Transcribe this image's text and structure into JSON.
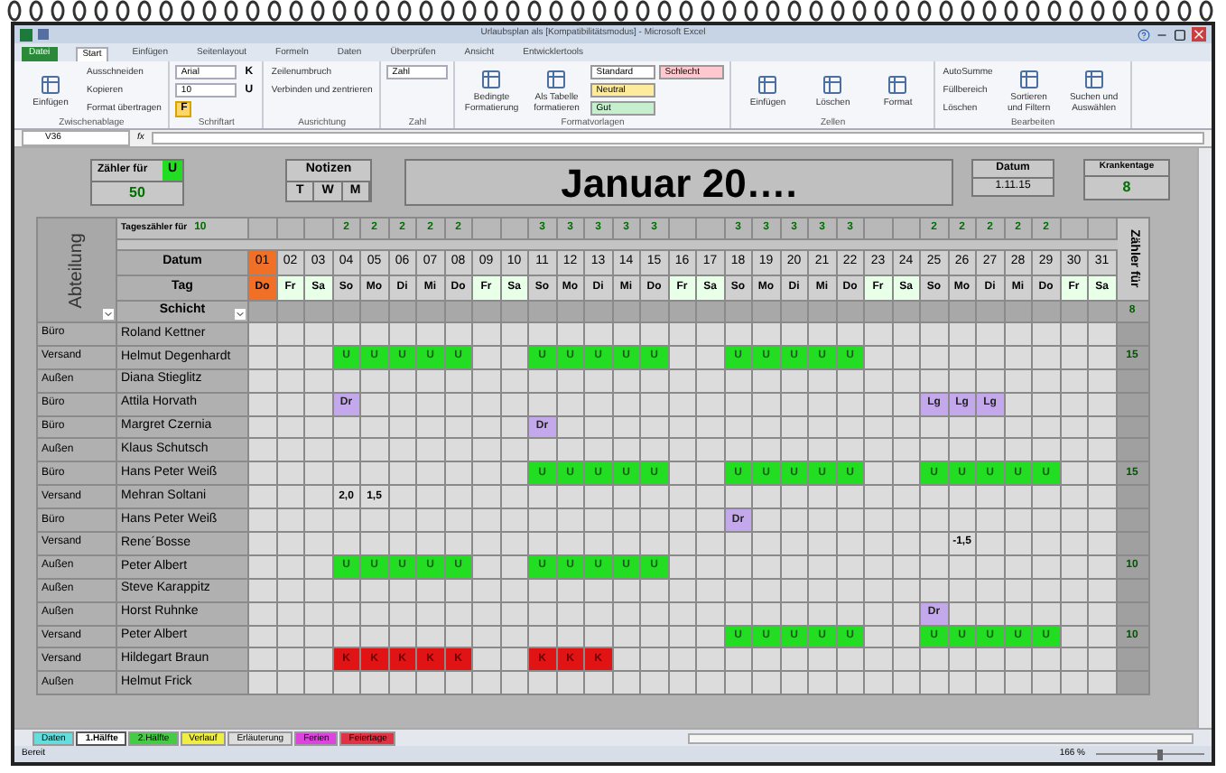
{
  "window": {
    "title": "Urlaubsplan als [Kompatibilitätsmodus] - Microsoft Excel"
  },
  "ribbon": {
    "file_tab": "Datei",
    "tabs": [
      {
        "label": "Start",
        "selected": true
      },
      {
        "label": "Einfügen",
        "selected": false
      },
      {
        "label": "Seitenlayout",
        "selected": false
      },
      {
        "label": "Formeln",
        "selected": false
      },
      {
        "label": "Daten",
        "selected": false
      },
      {
        "label": "Überprüfen",
        "selected": false
      },
      {
        "label": "Ansicht",
        "selected": false
      },
      {
        "label": "Entwicklertools",
        "selected": false
      }
    ],
    "groups": [
      {
        "label": "Zwischenablage",
        "items": [
          {
            "kind": "large",
            "label": "Einfügen"
          },
          {
            "kind": "small",
            "label": "Ausschneiden"
          },
          {
            "kind": "small",
            "label": "Kopieren"
          },
          {
            "kind": "small",
            "label": "Format übertragen"
          }
        ]
      },
      {
        "label": "Schriftart",
        "items": [
          {
            "kind": "field",
            "label": "Arial"
          },
          {
            "kind": "field",
            "label": "10"
          },
          {
            "kind": "toggle",
            "label": "F",
            "selected": true
          },
          {
            "kind": "toggle",
            "label": "K",
            "selected": false
          },
          {
            "kind": "toggle",
            "label": "U",
            "selected": false
          }
        ]
      },
      {
        "label": "Ausrichtung",
        "items": [
          {
            "kind": "small",
            "label": "Zeilenumbruch"
          },
          {
            "kind": "small",
            "label": "Verbinden und zentrieren"
          }
        ]
      },
      {
        "label": "Zahl",
        "items": [
          {
            "kind": "field",
            "label": "Zahl"
          }
        ]
      },
      {
        "label": "Formatvorlagen",
        "items": [
          {
            "kind": "large",
            "label": "Bedingte Formatierung"
          },
          {
            "kind": "large",
            "label": "Als Tabelle formatieren"
          },
          {
            "kind": "style",
            "label": "Standard",
            "color": "#ffffff"
          },
          {
            "kind": "style",
            "label": "Neutral",
            "color": "#ffeb9c"
          },
          {
            "kind": "style",
            "label": "Gut",
            "color": "#c6efce"
          },
          {
            "kind": "style",
            "label": "Schlecht",
            "color": "#ffc7ce"
          }
        ]
      },
      {
        "label": "Zellen",
        "items": [
          {
            "kind": "large",
            "label": "Einfügen"
          },
          {
            "kind": "large",
            "label": "Löschen"
          },
          {
            "kind": "large",
            "label": "Format"
          }
        ]
      },
      {
        "label": "Bearbeiten",
        "items": [
          {
            "kind": "small",
            "label": "AutoSumme"
          },
          {
            "kind": "small",
            "label": "Füllbereich"
          },
          {
            "kind": "small",
            "label": "Löschen"
          },
          {
            "kind": "large",
            "label": "Sortieren und Filtern"
          },
          {
            "kind": "large",
            "label": "Suchen und Auswählen"
          }
        ]
      }
    ]
  },
  "formula_bar": {
    "name_box": "V36",
    "function_label": "fx"
  },
  "header": {
    "counter_label": "Zähler für",
    "counter_code": "U",
    "counter_value": "50",
    "notes_title": "Notizen",
    "notes_columns": [
      "T",
      "W",
      "M"
    ],
    "title": "Januar 20….",
    "date_label": "Datum",
    "date_value": "1.11.15",
    "sick_label": "Krankentage",
    "sick_value": "8"
  },
  "grid": {
    "department_heading": "Abteilung",
    "day_counter_label": "Tageszähler für",
    "day_counter_value": "10",
    "date_heading": "Datum",
    "weekday_heading": "Tag",
    "shift_heading": "Schicht",
    "total_heading": "Zähler für",
    "shift_total": "8",
    "days": [
      {
        "date": "01",
        "weekday": "Do",
        "kind": "holiday"
      },
      {
        "date": "02",
        "weekday": "Fr",
        "kind": "weekend"
      },
      {
        "date": "03",
        "weekday": "Sa",
        "kind": "weekend"
      },
      {
        "date": "04",
        "weekday": "So",
        "kind": "normal",
        "counter": "2"
      },
      {
        "date": "05",
        "weekday": "Mo",
        "kind": "normal",
        "counter": "2"
      },
      {
        "date": "06",
        "weekday": "Di",
        "kind": "normal",
        "counter": "2"
      },
      {
        "date": "07",
        "weekday": "Mi",
        "kind": "normal",
        "counter": "2"
      },
      {
        "date": "08",
        "weekday": "Do",
        "kind": "normal",
        "counter": "2"
      },
      {
        "date": "09",
        "weekday": "Fr",
        "kind": "weekend"
      },
      {
        "date": "10",
        "weekday": "Sa",
        "kind": "weekend"
      },
      {
        "date": "11",
        "weekday": "So",
        "kind": "normal",
        "counter": "3"
      },
      {
        "date": "12",
        "weekday": "Mo",
        "kind": "normal",
        "counter": "3"
      },
      {
        "date": "13",
        "weekday": "Di",
        "kind": "normal",
        "counter": "3"
      },
      {
        "date": "14",
        "weekday": "Mi",
        "kind": "normal",
        "counter": "3"
      },
      {
        "date": "15",
        "weekday": "Do",
        "kind": "normal",
        "counter": "3"
      },
      {
        "date": "16",
        "weekday": "Fr",
        "kind": "weekend"
      },
      {
        "date": "17",
        "weekday": "Sa",
        "kind": "weekend"
      },
      {
        "date": "18",
        "weekday": "So",
        "kind": "normal",
        "counter": "3"
      },
      {
        "date": "19",
        "weekday": "Mo",
        "kind": "normal",
        "counter": "3"
      },
      {
        "date": "20",
        "weekday": "Di",
        "kind": "normal",
        "counter": "3"
      },
      {
        "date": "21",
        "weekday": "Mi",
        "kind": "normal",
        "counter": "3"
      },
      {
        "date": "22",
        "weekday": "Do",
        "kind": "normal",
        "counter": "3"
      },
      {
        "date": "23",
        "weekday": "Fr",
        "kind": "weekend"
      },
      {
        "date": "24",
        "weekday": "Sa",
        "kind": "weekend"
      },
      {
        "date": "25",
        "weekday": "So",
        "kind": "normal",
        "counter": "2"
      },
      {
        "date": "26",
        "weekday": "Mo",
        "kind": "normal",
        "counter": "2"
      },
      {
        "date": "27",
        "weekday": "Di",
        "kind": "normal",
        "counter": "2"
      },
      {
        "date": "28",
        "weekday": "Mi",
        "kind": "normal",
        "counter": "2"
      },
      {
        "date": "29",
        "weekday": "Do",
        "kind": "normal",
        "counter": "2"
      },
      {
        "date": "30",
        "weekday": "Fr",
        "kind": "weekend"
      },
      {
        "date": "31",
        "weekday": "Sa",
        "kind": "weekend"
      }
    ],
    "employees": [
      {
        "department": "Büro",
        "name": "Roland Kettner",
        "cells": [
          {
            "kind": "empty"
          },
          {
            "kind": "empty"
          },
          {
            "kind": "empty"
          },
          {
            "kind": "empty"
          },
          {
            "kind": "empty"
          },
          {
            "kind": "empty"
          },
          {
            "kind": "empty"
          },
          {
            "kind": "empty"
          },
          {
            "kind": "empty"
          },
          {
            "kind": "empty"
          },
          {
            "kind": "empty"
          },
          {
            "kind": "empty"
          },
          {
            "kind": "empty"
          },
          {
            "kind": "empty"
          },
          {
            "kind": "empty"
          },
          {
            "kind": "empty"
          },
          {
            "kind": "empty"
          },
          {
            "kind": "empty"
          },
          {
            "kind": "empty"
          },
          {
            "kind": "empty"
          },
          {
            "kind": "empty"
          },
          {
            "kind": "empty"
          },
          {
            "kind": "empty"
          },
          {
            "kind": "empty"
          },
          {
            "kind": "empty"
          },
          {
            "kind": "empty"
          },
          {
            "kind": "empty"
          },
          {
            "kind": "empty"
          },
          {
            "kind": "empty"
          },
          {
            "kind": "empty"
          },
          {
            "kind": "empty"
          }
        ]
      },
      {
        "department": "Versand",
        "name": "Helmut Degenhardt",
        "total": "15",
        "cells": [
          {
            "kind": "empty"
          },
          {
            "kind": "empty"
          },
          {
            "kind": "empty"
          },
          {
            "kind": "vacation",
            "text": "U"
          },
          {
            "kind": "vacation",
            "text": "U"
          },
          {
            "kind": "vacation",
            "text": "U"
          },
          {
            "kind": "vacation",
            "text": "U"
          },
          {
            "kind": "vacation",
            "text": "U"
          },
          {
            "kind": "empty"
          },
          {
            "kind": "empty"
          },
          {
            "kind": "vacation",
            "text": "U"
          },
          {
            "kind": "vacation",
            "text": "U"
          },
          {
            "kind": "vacation",
            "text": "U"
          },
          {
            "kind": "vacation",
            "text": "U"
          },
          {
            "kind": "vacation",
            "text": "U"
          },
          {
            "kind": "empty"
          },
          {
            "kind": "empty"
          },
          {
            "kind": "vacation",
            "text": "U"
          },
          {
            "kind": "vacation",
            "text": "U"
          },
          {
            "kind": "vacation",
            "text": "U"
          },
          {
            "kind": "vacation",
            "text": "U"
          },
          {
            "kind": "vacation",
            "text": "U"
          },
          {
            "kind": "empty"
          },
          {
            "kind": "empty"
          },
          {
            "kind": "empty"
          },
          {
            "kind": "empty"
          },
          {
            "kind": "empty"
          },
          {
            "kind": "empty"
          },
          {
            "kind": "empty"
          },
          {
            "kind": "empty"
          },
          {
            "kind": "empty"
          }
        ]
      },
      {
        "department": "Außen",
        "name": "Diana Stieglitz",
        "cells": [
          {
            "kind": "empty"
          },
          {
            "kind": "empty"
          },
          {
            "kind": "empty"
          },
          {
            "kind": "empty"
          },
          {
            "kind": "empty"
          },
          {
            "kind": "empty"
          },
          {
            "kind": "empty"
          },
          {
            "kind": "empty"
          },
          {
            "kind": "empty"
          },
          {
            "kind": "empty"
          },
          {
            "kind": "empty"
          },
          {
            "kind": "empty"
          },
          {
            "kind": "empty"
          },
          {
            "kind": "empty"
          },
          {
            "kind": "empty"
          },
          {
            "kind": "empty"
          },
          {
            "kind": "empty"
          },
          {
            "kind": "empty"
          },
          {
            "kind": "empty"
          },
          {
            "kind": "empty"
          },
          {
            "kind": "empty"
          },
          {
            "kind": "empty"
          },
          {
            "kind": "empty"
          },
          {
            "kind": "empty"
          },
          {
            "kind": "empty"
          },
          {
            "kind": "empty"
          },
          {
            "kind": "empty"
          },
          {
            "kind": "empty"
          },
          {
            "kind": "empty"
          },
          {
            "kind": "empty"
          },
          {
            "kind": "empty"
          }
        ]
      },
      {
        "department": "Büro",
        "name": "Attila Horvath",
        "cells": [
          {
            "kind": "empty"
          },
          {
            "kind": "empty"
          },
          {
            "kind": "empty"
          },
          {
            "kind": "training",
            "text": "Dr"
          },
          {
            "kind": "empty"
          },
          {
            "kind": "empty"
          },
          {
            "kind": "empty"
          },
          {
            "kind": "empty"
          },
          {
            "kind": "empty"
          },
          {
            "kind": "empty"
          },
          {
            "kind": "empty"
          },
          {
            "kind": "empty"
          },
          {
            "kind": "empty"
          },
          {
            "kind": "empty"
          },
          {
            "kind": "empty"
          },
          {
            "kind": "empty"
          },
          {
            "kind": "empty"
          },
          {
            "kind": "empty"
          },
          {
            "kind": "empty"
          },
          {
            "kind": "empty"
          },
          {
            "kind": "empty"
          },
          {
            "kind": "empty"
          },
          {
            "kind": "empty"
          },
          {
            "kind": "empty"
          },
          {
            "kind": "training",
            "text": "Lg"
          },
          {
            "kind": "training",
            "text": "Lg"
          },
          {
            "kind": "training",
            "text": "Lg"
          },
          {
            "kind": "empty"
          },
          {
            "kind": "empty"
          },
          {
            "kind": "empty"
          },
          {
            "kind": "empty"
          }
        ]
      },
      {
        "department": "Büro",
        "name": "Margret Czernia",
        "cells": [
          {
            "kind": "empty"
          },
          {
            "kind": "empty"
          },
          {
            "kind": "empty"
          },
          {
            "kind": "empty"
          },
          {
            "kind": "empty"
          },
          {
            "kind": "empty"
          },
          {
            "kind": "empty"
          },
          {
            "kind": "empty"
          },
          {
            "kind": "empty"
          },
          {
            "kind": "empty"
          },
          {
            "kind": "training",
            "text": "Dr"
          },
          {
            "kind": "empty"
          },
          {
            "kind": "empty"
          },
          {
            "kind": "empty"
          },
          {
            "kind": "empty"
          },
          {
            "kind": "empty"
          },
          {
            "kind": "empty"
          },
          {
            "kind": "empty"
          },
          {
            "kind": "empty"
          },
          {
            "kind": "empty"
          },
          {
            "kind": "empty"
          },
          {
            "kind": "empty"
          },
          {
            "kind": "empty"
          },
          {
            "kind": "empty"
          },
          {
            "kind": "empty"
          },
          {
            "kind": "empty"
          },
          {
            "kind": "empty"
          },
          {
            "kind": "empty"
          },
          {
            "kind": "empty"
          },
          {
            "kind": "empty"
          },
          {
            "kind": "empty"
          }
        ]
      },
      {
        "department": "Außen",
        "name": "Klaus Schutsch",
        "cells": [
          {
            "kind": "empty"
          },
          {
            "kind": "empty"
          },
          {
            "kind": "empty"
          },
          {
            "kind": "empty"
          },
          {
            "kind": "empty"
          },
          {
            "kind": "empty"
          },
          {
            "kind": "empty"
          },
          {
            "kind": "empty"
          },
          {
            "kind": "empty"
          },
          {
            "kind": "empty"
          },
          {
            "kind": "empty"
          },
          {
            "kind": "empty"
          },
          {
            "kind": "empty"
          },
          {
            "kind": "empty"
          },
          {
            "kind": "empty"
          },
          {
            "kind": "empty"
          },
          {
            "kind": "empty"
          },
          {
            "kind": "empty"
          },
          {
            "kind": "empty"
          },
          {
            "kind": "empty"
          },
          {
            "kind": "empty"
          },
          {
            "kind": "empty"
          },
          {
            "kind": "empty"
          },
          {
            "kind": "empty"
          },
          {
            "kind": "empty"
          },
          {
            "kind": "empty"
          },
          {
            "kind": "empty"
          },
          {
            "kind": "empty"
          },
          {
            "kind": "empty"
          },
          {
            "kind": "empty"
          },
          {
            "kind": "empty"
          }
        ]
      },
      {
        "department": "Büro",
        "name": "Hans Peter Weiß",
        "total": "15",
        "cells": [
          {
            "kind": "empty"
          },
          {
            "kind": "empty"
          },
          {
            "kind": "empty"
          },
          {
            "kind": "empty"
          },
          {
            "kind": "empty"
          },
          {
            "kind": "empty"
          },
          {
            "kind": "empty"
          },
          {
            "kind": "empty"
          },
          {
            "kind": "empty"
          },
          {
            "kind": "empty"
          },
          {
            "kind": "vacation",
            "text": "U"
          },
          {
            "kind": "vacation",
            "text": "U"
          },
          {
            "kind": "vacation",
            "text": "U"
          },
          {
            "kind": "vacation",
            "text": "U"
          },
          {
            "kind": "vacation",
            "text": "U"
          },
          {
            "kind": "empty"
          },
          {
            "kind": "empty"
          },
          {
            "kind": "vacation",
            "text": "U"
          },
          {
            "kind": "vacation",
            "text": "U"
          },
          {
            "kind": "vacation",
            "text": "U"
          },
          {
            "kind": "vacation",
            "text": "U"
          },
          {
            "kind": "vacation",
            "text": "U"
          },
          {
            "kind": "empty"
          },
          {
            "kind": "empty"
          },
          {
            "kind": "vacation",
            "text": "U"
          },
          {
            "kind": "vacation",
            "text": "U"
          },
          {
            "kind": "vacation",
            "text": "U"
          },
          {
            "kind": "vacation",
            "text": "U"
          },
          {
            "kind": "vacation",
            "text": "U"
          },
          {
            "kind": "empty"
          },
          {
            "kind": "empty"
          }
        ]
      },
      {
        "department": "Versand",
        "name": "Mehran Soltani",
        "cells": [
          {
            "kind": "empty"
          },
          {
            "kind": "empty"
          },
          {
            "kind": "empty"
          },
          {
            "kind": "hours",
            "text": "2,0"
          },
          {
            "kind": "hours",
            "text": "1,5"
          },
          {
            "kind": "empty"
          },
          {
            "kind": "empty"
          },
          {
            "kind": "empty"
          },
          {
            "kind": "empty"
          },
          {
            "kind": "empty"
          },
          {
            "kind": "empty"
          },
          {
            "kind": "empty"
          },
          {
            "kind": "empty"
          },
          {
            "kind": "empty"
          },
          {
            "kind": "empty"
          },
          {
            "kind": "empty"
          },
          {
            "kind": "empty"
          },
          {
            "kind": "empty"
          },
          {
            "kind": "empty"
          },
          {
            "kind": "empty"
          },
          {
            "kind": "empty"
          },
          {
            "kind": "empty"
          },
          {
            "kind": "empty"
          },
          {
            "kind": "empty"
          },
          {
            "kind": "empty"
          },
          {
            "kind": "empty"
          },
          {
            "kind": "empty"
          },
          {
            "kind": "empty"
          },
          {
            "kind": "empty"
          },
          {
            "kind": "empty"
          },
          {
            "kind": "empty"
          }
        ]
      },
      {
        "department": "Büro",
        "name": "Hans Peter Weiß",
        "cells": [
          {
            "kind": "empty"
          },
          {
            "kind": "empty"
          },
          {
            "kind": "empty"
          },
          {
            "kind": "empty"
          },
          {
            "kind": "empty"
          },
          {
            "kind": "empty"
          },
          {
            "kind": "empty"
          },
          {
            "kind": "empty"
          },
          {
            "kind": "empty"
          },
          {
            "kind": "empty"
          },
          {
            "kind": "empty"
          },
          {
            "kind": "empty"
          },
          {
            "kind": "empty"
          },
          {
            "kind": "empty"
          },
          {
            "kind": "empty"
          },
          {
            "kind": "empty"
          },
          {
            "kind": "empty"
          },
          {
            "kind": "training",
            "text": "Dr"
          },
          {
            "kind": "empty"
          },
          {
            "kind": "empty"
          },
          {
            "kind": "empty"
          },
          {
            "kind": "empty"
          },
          {
            "kind": "empty"
          },
          {
            "kind": "empty"
          },
          {
            "kind": "empty"
          },
          {
            "kind": "empty"
          },
          {
            "kind": "empty"
          },
          {
            "kind": "empty"
          },
          {
            "kind": "empty"
          },
          {
            "kind": "empty"
          },
          {
            "kind": "empty"
          }
        ]
      },
      {
        "department": "Versand",
        "name": "Rene´Bosse",
        "cells": [
          {
            "kind": "empty"
          },
          {
            "kind": "empty"
          },
          {
            "kind": "empty"
          },
          {
            "kind": "empty"
          },
          {
            "kind": "empty"
          },
          {
            "kind": "empty"
          },
          {
            "kind": "empty"
          },
          {
            "kind": "empty"
          },
          {
            "kind": "empty"
          },
          {
            "kind": "empty"
          },
          {
            "kind": "empty"
          },
          {
            "kind": "empty"
          },
          {
            "kind": "empty"
          },
          {
            "kind": "empty"
          },
          {
            "kind": "empty"
          },
          {
            "kind": "empty"
          },
          {
            "kind": "empty"
          },
          {
            "kind": "empty"
          },
          {
            "kind": "empty"
          },
          {
            "kind": "empty"
          },
          {
            "kind": "empty"
          },
          {
            "kind": "empty"
          },
          {
            "kind": "empty"
          },
          {
            "kind": "empty"
          },
          {
            "kind": "empty"
          },
          {
            "kind": "hours",
            "text": "-1,5"
          },
          {
            "kind": "empty"
          },
          {
            "kind": "empty"
          },
          {
            "kind": "empty"
          },
          {
            "kind": "empty"
          },
          {
            "kind": "empty"
          }
        ]
      },
      {
        "department": "Außen",
        "name": "Peter Albert",
        "total": "10",
        "cells": [
          {
            "kind": "empty"
          },
          {
            "kind": "empty"
          },
          {
            "kind": "empty"
          },
          {
            "kind": "vacation",
            "text": "U"
          },
          {
            "kind": "vacation",
            "text": "U"
          },
          {
            "kind": "vacation",
            "text": "U"
          },
          {
            "kind": "vacation",
            "text": "U"
          },
          {
            "kind": "vacation",
            "text": "U"
          },
          {
            "kind": "empty"
          },
          {
            "kind": "empty"
          },
          {
            "kind": "vacation",
            "text": "U"
          },
          {
            "kind": "vacation",
            "text": "U"
          },
          {
            "kind": "vacation",
            "text": "U"
          },
          {
            "kind": "vacation",
            "text": "U"
          },
          {
            "kind": "vacation",
            "text": "U"
          },
          {
            "kind": "empty"
          },
          {
            "kind": "empty"
          },
          {
            "kind": "empty"
          },
          {
            "kind": "empty"
          },
          {
            "kind": "empty"
          },
          {
            "kind": "empty"
          },
          {
            "kind": "empty"
          },
          {
            "kind": "empty"
          },
          {
            "kind": "empty"
          },
          {
            "kind": "empty"
          },
          {
            "kind": "empty"
          },
          {
            "kind": "empty"
          },
          {
            "kind": "empty"
          },
          {
            "kind": "empty"
          },
          {
            "kind": "empty"
          },
          {
            "kind": "empty"
          }
        ]
      },
      {
        "department": "Außen",
        "name": "Steve Karappitz",
        "cells": [
          {
            "kind": "empty"
          },
          {
            "kind": "empty"
          },
          {
            "kind": "empty"
          },
          {
            "kind": "empty"
          },
          {
            "kind": "empty"
          },
          {
            "kind": "empty"
          },
          {
            "kind": "empty"
          },
          {
            "kind": "empty"
          },
          {
            "kind": "empty"
          },
          {
            "kind": "empty"
          },
          {
            "kind": "empty"
          },
          {
            "kind": "empty"
          },
          {
            "kind": "empty"
          },
          {
            "kind": "empty"
          },
          {
            "kind": "empty"
          },
          {
            "kind": "empty"
          },
          {
            "kind": "empty"
          },
          {
            "kind": "empty"
          },
          {
            "kind": "empty"
          },
          {
            "kind": "empty"
          },
          {
            "kind": "empty"
          },
          {
            "kind": "empty"
          },
          {
            "kind": "empty"
          },
          {
            "kind": "empty"
          },
          {
            "kind": "empty"
          },
          {
            "kind": "empty"
          },
          {
            "kind": "empty"
          },
          {
            "kind": "empty"
          },
          {
            "kind": "empty"
          },
          {
            "kind": "empty"
          },
          {
            "kind": "empty"
          }
        ]
      },
      {
        "department": "Außen",
        "name": "Horst Ruhnke",
        "cells": [
          {
            "kind": "empty"
          },
          {
            "kind": "empty"
          },
          {
            "kind": "empty"
          },
          {
            "kind": "empty"
          },
          {
            "kind": "empty"
          },
          {
            "kind": "empty"
          },
          {
            "kind": "empty"
          },
          {
            "kind": "empty"
          },
          {
            "kind": "empty"
          },
          {
            "kind": "empty"
          },
          {
            "kind": "empty"
          },
          {
            "kind": "empty"
          },
          {
            "kind": "empty"
          },
          {
            "kind": "empty"
          },
          {
            "kind": "empty"
          },
          {
            "kind": "empty"
          },
          {
            "kind": "empty"
          },
          {
            "kind": "empty"
          },
          {
            "kind": "empty"
          },
          {
            "kind": "empty"
          },
          {
            "kind": "empty"
          },
          {
            "kind": "empty"
          },
          {
            "kind": "empty"
          },
          {
            "kind": "empty"
          },
          {
            "kind": "training",
            "text": "Dr"
          },
          {
            "kind": "empty"
          },
          {
            "kind": "empty"
          },
          {
            "kind": "empty"
          },
          {
            "kind": "empty"
          },
          {
            "kind": "empty"
          },
          {
            "kind": "empty"
          }
        ]
      },
      {
        "department": "Versand",
        "name": "Peter Albert",
        "total": "10",
        "cells": [
          {
            "kind": "empty"
          },
          {
            "kind": "empty"
          },
          {
            "kind": "empty"
          },
          {
            "kind": "empty"
          },
          {
            "kind": "empty"
          },
          {
            "kind": "empty"
          },
          {
            "kind": "empty"
          },
          {
            "kind": "empty"
          },
          {
            "kind": "empty"
          },
          {
            "kind": "empty"
          },
          {
            "kind": "empty"
          },
          {
            "kind": "empty"
          },
          {
            "kind": "empty"
          },
          {
            "kind": "empty"
          },
          {
            "kind": "empty"
          },
          {
            "kind": "empty"
          },
          {
            "kind": "empty"
          },
          {
            "kind": "vacation",
            "text": "U"
          },
          {
            "kind": "vacation",
            "text": "U"
          },
          {
            "kind": "vacation",
            "text": "U"
          },
          {
            "kind": "vacation",
            "text": "U"
          },
          {
            "kind": "vacation",
            "text": "U"
          },
          {
            "kind": "empty"
          },
          {
            "kind": "empty"
          },
          {
            "kind": "vacation",
            "text": "U"
          },
          {
            "kind": "vacation",
            "text": "U"
          },
          {
            "kind": "vacation",
            "text": "U"
          },
          {
            "kind": "vacation",
            "text": "U"
          },
          {
            "kind": "vacation",
            "text": "U"
          },
          {
            "kind": "empty"
          },
          {
            "kind": "empty"
          }
        ]
      },
      {
        "department": "Versand",
        "name": "Hildegart Braun",
        "cells": [
          {
            "kind": "empty"
          },
          {
            "kind": "empty"
          },
          {
            "kind": "empty"
          },
          {
            "kind": "sick",
            "text": "K"
          },
          {
            "kind": "sick",
            "text": "K"
          },
          {
            "kind": "sick",
            "text": "K"
          },
          {
            "kind": "sick",
            "text": "K"
          },
          {
            "kind": "sick",
            "text": "K"
          },
          {
            "kind": "empty"
          },
          {
            "kind": "empty"
          },
          {
            "kind": "sick",
            "text": "K"
          },
          {
            "kind": "sick",
            "text": "K"
          },
          {
            "kind": "sick",
            "text": "K"
          },
          {
            "kind": "empty"
          },
          {
            "kind": "empty"
          },
          {
            "kind": "empty"
          },
          {
            "kind": "empty"
          },
          {
            "kind": "empty"
          },
          {
            "kind": "empty"
          },
          {
            "kind": "empty"
          },
          {
            "kind": "empty"
          },
          {
            "kind": "empty"
          },
          {
            "kind": "empty"
          },
          {
            "kind": "empty"
          },
          {
            "kind": "empty"
          },
          {
            "kind": "empty"
          },
          {
            "kind": "empty"
          },
          {
            "kind": "empty"
          },
          {
            "kind": "empty"
          },
          {
            "kind": "empty"
          },
          {
            "kind": "empty"
          }
        ]
      },
      {
        "department": "Außen",
        "name": "Helmut Frick",
        "cells": [
          {
            "kind": "empty"
          },
          {
            "kind": "empty"
          },
          {
            "kind": "empty"
          },
          {
            "kind": "empty"
          },
          {
            "kind": "empty"
          },
          {
            "kind": "empty"
          },
          {
            "kind": "empty"
          },
          {
            "kind": "empty"
          },
          {
            "kind": "empty"
          },
          {
            "kind": "empty"
          },
          {
            "kind": "empty"
          },
          {
            "kind": "empty"
          },
          {
            "kind": "empty"
          },
          {
            "kind": "empty"
          },
          {
            "kind": "empty"
          },
          {
            "kind": "empty"
          },
          {
            "kind": "empty"
          },
          {
            "kind": "empty"
          },
          {
            "kind": "empty"
          },
          {
            "kind": "empty"
          },
          {
            "kind": "empty"
          },
          {
            "kind": "empty"
          },
          {
            "kind": "empty"
          },
          {
            "kind": "empty"
          },
          {
            "kind": "empty"
          },
          {
            "kind": "empty"
          },
          {
            "kind": "empty"
          },
          {
            "kind": "empty"
          },
          {
            "kind": "empty"
          },
          {
            "kind": "empty"
          },
          {
            "kind": "empty"
          }
        ]
      }
    ]
  },
  "sheet_tabs": [
    {
      "label": "Daten",
      "selected": false,
      "color": "#66dddd"
    },
    {
      "label": "1.Hälfte",
      "selected": true,
      "color": "#ffffff"
    },
    {
      "label": "2.Hälfte",
      "selected": false,
      "color": "#44cc44"
    },
    {
      "label": "Verlauf",
      "selected": false,
      "color": "#eeee44"
    },
    {
      "label": "Erläuterung",
      "selected": false,
      "color": "#dddddd"
    },
    {
      "label": "Ferien",
      "selected": false,
      "color": "#dd44dd"
    },
    {
      "label": "Feiertage",
      "selected": false,
      "color": "#dd3344"
    }
  ],
  "status_bar": {
    "status": "Bereit",
    "zoom": "166 %",
    "zoom_slider": {
      "level": 0.6
    }
  }
}
